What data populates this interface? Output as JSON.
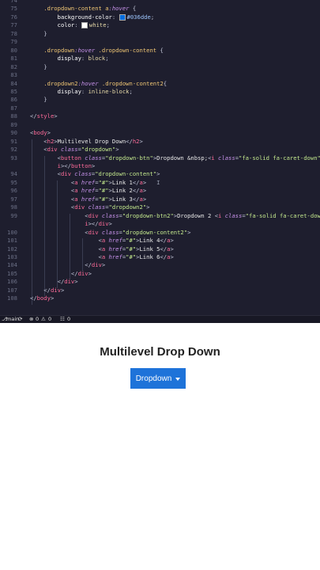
{
  "editor": {
    "lines": [
      {
        "num": "74",
        "tokens": []
      },
      {
        "num": "75",
        "tokens": [
          [
            "sel",
            "    .dropdown-content a"
          ],
          [
            "pseudo",
            ":hover"
          ],
          [
            "punc",
            " {"
          ]
        ]
      },
      {
        "num": "76",
        "tokens": [
          [
            "prop",
            "        background-color"
          ],
          [
            "punc",
            ": "
          ],
          [
            "swatch",
            "#036dde"
          ],
          [
            "hex",
            "#036dde"
          ],
          [
            "punc",
            ";"
          ]
        ]
      },
      {
        "num": "77",
        "tokens": [
          [
            "prop",
            "        color"
          ],
          [
            "punc",
            ": "
          ],
          [
            "swatch",
            "white"
          ],
          [
            "val",
            "white"
          ],
          [
            "punc",
            ";"
          ]
        ]
      },
      {
        "num": "78",
        "tokens": [
          [
            "punc",
            "    }"
          ]
        ]
      },
      {
        "num": "79",
        "tokens": []
      },
      {
        "num": "80",
        "tokens": [
          [
            "sel",
            "    .dropdown"
          ],
          [
            "pseudo",
            ":hover"
          ],
          [
            "sel",
            " .dropdown-content"
          ],
          [
            "punc",
            " {"
          ]
        ]
      },
      {
        "num": "81",
        "tokens": [
          [
            "prop",
            "        display"
          ],
          [
            "punc",
            ": "
          ],
          [
            "val",
            "block"
          ],
          [
            "punc",
            ";"
          ]
        ]
      },
      {
        "num": "82",
        "tokens": [
          [
            "punc",
            "    }"
          ]
        ]
      },
      {
        "num": "83",
        "tokens": []
      },
      {
        "num": "84",
        "tokens": [
          [
            "sel",
            "    .dropdown2"
          ],
          [
            "pseudo",
            ":hover"
          ],
          [
            "sel",
            " .dropdown-content2"
          ],
          [
            "punc",
            "{"
          ]
        ]
      },
      {
        "num": "85",
        "tokens": [
          [
            "prop",
            "        display"
          ],
          [
            "punc",
            ": "
          ],
          [
            "val",
            "inline-block"
          ],
          [
            "punc",
            ";"
          ]
        ]
      },
      {
        "num": "86",
        "tokens": [
          [
            "punc",
            "    }"
          ]
        ]
      },
      {
        "num": "87",
        "tokens": []
      },
      {
        "num": "88",
        "tokens": [
          [
            "punc",
            "</"
          ],
          [
            "tag",
            "style"
          ],
          [
            "punc",
            ">"
          ]
        ]
      },
      {
        "num": "89",
        "tokens": []
      },
      {
        "num": "90",
        "tokens": [
          [
            "punc",
            "<"
          ],
          [
            "tag",
            "body"
          ],
          [
            "punc",
            ">"
          ]
        ]
      },
      {
        "num": "91",
        "tokens": [
          [
            "punc",
            "    <"
          ],
          [
            "tag",
            "h2"
          ],
          [
            "punc",
            ">"
          ],
          [
            "text",
            "Multilevel Drop Down"
          ],
          [
            "punc",
            "</"
          ],
          [
            "tag",
            "h2"
          ],
          [
            "punc",
            ">"
          ]
        ]
      },
      {
        "num": "92",
        "tokens": [
          [
            "punc",
            "    <"
          ],
          [
            "tag",
            "div"
          ],
          [
            "attr",
            " class"
          ],
          [
            "punc",
            "="
          ],
          [
            "str",
            "\"dropdown\""
          ],
          [
            "punc",
            ">"
          ]
        ]
      },
      {
        "num": "93",
        "tokens": [
          [
            "punc",
            "        <"
          ],
          [
            "tag",
            "button"
          ],
          [
            "attr",
            " class"
          ],
          [
            "punc",
            "="
          ],
          [
            "str",
            "\"dropdown-btn\""
          ],
          [
            "punc",
            ">"
          ],
          [
            "text",
            "Dropdown &nbsp;"
          ],
          [
            "punc",
            "<"
          ],
          [
            "tag",
            "i"
          ],
          [
            "attr",
            " class"
          ],
          [
            "punc",
            "="
          ],
          [
            "str",
            "\"fa-solid fa-caret-down\""
          ],
          [
            "punc",
            "></"
          ]
        ]
      },
      {
        "num": "",
        "tokens": [
          [
            "tag",
            "        i"
          ],
          [
            "punc",
            "></"
          ],
          [
            "tag",
            "button"
          ],
          [
            "punc",
            ">"
          ]
        ]
      },
      {
        "num": "94",
        "tokens": [
          [
            "punc",
            "        <"
          ],
          [
            "tag",
            "div"
          ],
          [
            "attr",
            " class"
          ],
          [
            "punc",
            "="
          ],
          [
            "str",
            "\"dropdown-content\""
          ],
          [
            "punc",
            ">"
          ]
        ]
      },
      {
        "num": "95",
        "tokens": [
          [
            "punc",
            "            <"
          ],
          [
            "tag",
            "a"
          ],
          [
            "attr",
            " href"
          ],
          [
            "punc",
            "="
          ],
          [
            "str",
            "\"#\""
          ],
          [
            "punc",
            ">"
          ],
          [
            "text",
            "Link 1"
          ],
          [
            "punc",
            "</"
          ],
          [
            "tag",
            "a"
          ],
          [
            "punc",
            ">"
          ],
          [
            "caret",
            "   I"
          ]
        ]
      },
      {
        "num": "96",
        "tokens": [
          [
            "punc",
            "            <"
          ],
          [
            "tag",
            "a"
          ],
          [
            "attr",
            " href"
          ],
          [
            "punc",
            "="
          ],
          [
            "str",
            "\"#\""
          ],
          [
            "punc",
            ">"
          ],
          [
            "text",
            "Link 2"
          ],
          [
            "punc",
            "</"
          ],
          [
            "tag",
            "a"
          ],
          [
            "punc",
            ">"
          ]
        ]
      },
      {
        "num": "97",
        "tokens": [
          [
            "punc",
            "            <"
          ],
          [
            "tag",
            "a"
          ],
          [
            "attr",
            " href"
          ],
          [
            "punc",
            "="
          ],
          [
            "str",
            "\"#\""
          ],
          [
            "punc",
            ">"
          ],
          [
            "text",
            "Link 3"
          ],
          [
            "punc",
            "</"
          ],
          [
            "tag",
            "a"
          ],
          [
            "punc",
            ">"
          ]
        ]
      },
      {
        "num": "98",
        "tokens": [
          [
            "punc",
            "            <"
          ],
          [
            "tag",
            "div"
          ],
          [
            "attr",
            " class"
          ],
          [
            "punc",
            "="
          ],
          [
            "str",
            "\"dropdown2\""
          ],
          [
            "punc",
            ">"
          ]
        ]
      },
      {
        "num": "99",
        "tokens": [
          [
            "punc",
            "                <"
          ],
          [
            "tag",
            "div"
          ],
          [
            "attr",
            " class"
          ],
          [
            "punc",
            "="
          ],
          [
            "str",
            "\"dropdown-btn2\""
          ],
          [
            "punc",
            ">"
          ],
          [
            "text",
            "Dropdown 2 "
          ],
          [
            "punc",
            "<"
          ],
          [
            "tag",
            "i"
          ],
          [
            "attr",
            " class"
          ],
          [
            "punc",
            "="
          ],
          [
            "str",
            "\"fa-solid fa-caret-dow"
          ]
        ]
      },
      {
        "num": "",
        "tokens": [
          [
            "tag",
            "                i"
          ],
          [
            "punc",
            "></"
          ],
          [
            "tag",
            "div"
          ],
          [
            "punc",
            ">"
          ]
        ]
      },
      {
        "num": "100",
        "tokens": [
          [
            "punc",
            "                <"
          ],
          [
            "tag",
            "div"
          ],
          [
            "attr",
            " class"
          ],
          [
            "punc",
            "="
          ],
          [
            "str",
            "\"dropdown-content2\""
          ],
          [
            "punc",
            ">"
          ]
        ]
      },
      {
        "num": "101",
        "tokens": [
          [
            "punc",
            "                    <"
          ],
          [
            "tag",
            "a"
          ],
          [
            "attr",
            " href"
          ],
          [
            "punc",
            "="
          ],
          [
            "str",
            "\"#\""
          ],
          [
            "punc",
            ">"
          ],
          [
            "text",
            "Link 4"
          ],
          [
            "punc",
            "</"
          ],
          [
            "tag",
            "a"
          ],
          [
            "punc",
            ">"
          ]
        ]
      },
      {
        "num": "102",
        "tokens": [
          [
            "punc",
            "                    <"
          ],
          [
            "tag",
            "a"
          ],
          [
            "attr",
            " href"
          ],
          [
            "punc",
            "="
          ],
          [
            "str",
            "\"#\""
          ],
          [
            "punc",
            ">"
          ],
          [
            "text",
            "Link 5"
          ],
          [
            "punc",
            "</"
          ],
          [
            "tag",
            "a"
          ],
          [
            "punc",
            ">"
          ]
        ]
      },
      {
        "num": "103",
        "tokens": [
          [
            "punc",
            "                    <"
          ],
          [
            "tag",
            "a"
          ],
          [
            "attr",
            " href"
          ],
          [
            "punc",
            "="
          ],
          [
            "str",
            "\"#\""
          ],
          [
            "punc",
            ">"
          ],
          [
            "text",
            "Link 6"
          ],
          [
            "punc",
            "</"
          ],
          [
            "tag",
            "a"
          ],
          [
            "punc",
            ">"
          ]
        ]
      },
      {
        "num": "104",
        "tokens": [
          [
            "punc",
            "                </"
          ],
          [
            "tag",
            "div"
          ],
          [
            "punc",
            ">"
          ]
        ]
      },
      {
        "num": "105",
        "tokens": [
          [
            "punc",
            "            </"
          ],
          [
            "tag",
            "div"
          ],
          [
            "punc",
            ">"
          ]
        ]
      },
      {
        "num": "106",
        "tokens": [
          [
            "punc",
            "        </"
          ],
          [
            "tag",
            "div"
          ],
          [
            "punc",
            ">"
          ]
        ]
      },
      {
        "num": "107",
        "tokens": [
          [
            "punc",
            "    </"
          ],
          [
            "tag",
            "div"
          ],
          [
            "punc",
            ">"
          ]
        ]
      },
      {
        "num": "108",
        "tokens": [
          [
            "punc",
            "</"
          ],
          [
            "tag",
            "body"
          ],
          [
            "punc",
            ">"
          ]
        ]
      }
    ]
  },
  "statusbar": {
    "branch": "main",
    "errors": "0",
    "warnings": "0",
    "ports": "0"
  },
  "preview": {
    "title": "Multilevel Drop Down",
    "button_label": "Dropdown"
  },
  "colors": {
    "editor_bg": "#1e1e2e",
    "button_bg": "#1e73d9"
  }
}
